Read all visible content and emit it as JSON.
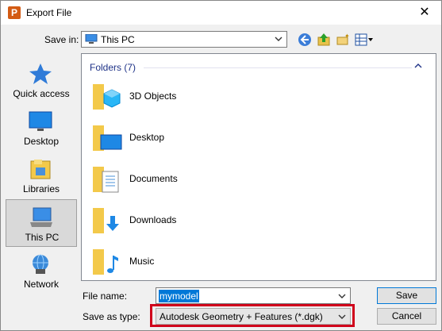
{
  "window": {
    "title": "Export File",
    "close_glyph": "✕"
  },
  "save_in": {
    "label": "Save in:",
    "value": "This PC"
  },
  "places": [
    {
      "label": "Quick access",
      "icon": "star-icon"
    },
    {
      "label": "Desktop",
      "icon": "desktop-icon"
    },
    {
      "label": "Libraries",
      "icon": "libraries-icon"
    },
    {
      "label": "This PC",
      "icon": "computer-icon",
      "selected": true
    },
    {
      "label": "Network",
      "icon": "network-icon"
    }
  ],
  "file_list": {
    "group_header": "Folders (7)",
    "items": [
      {
        "name": "3D Objects",
        "icon": "3d-objects-folder-icon"
      },
      {
        "name": "Desktop",
        "icon": "desktop-folder-icon"
      },
      {
        "name": "Documents",
        "icon": "documents-folder-icon"
      },
      {
        "name": "Downloads",
        "icon": "downloads-folder-icon"
      },
      {
        "name": "Music",
        "icon": "music-folder-icon"
      }
    ]
  },
  "file_name": {
    "label": "File name:",
    "value": "mymodel"
  },
  "save_as_type": {
    "label": "Save as type:",
    "value": "Autodesk Geometry + Features (*.dgk)"
  },
  "buttons": {
    "save": "Save",
    "cancel": "Cancel"
  },
  "colors": {
    "accent": "#0078d7",
    "highlight": "#d0021b",
    "group_header": "#1e3287"
  }
}
